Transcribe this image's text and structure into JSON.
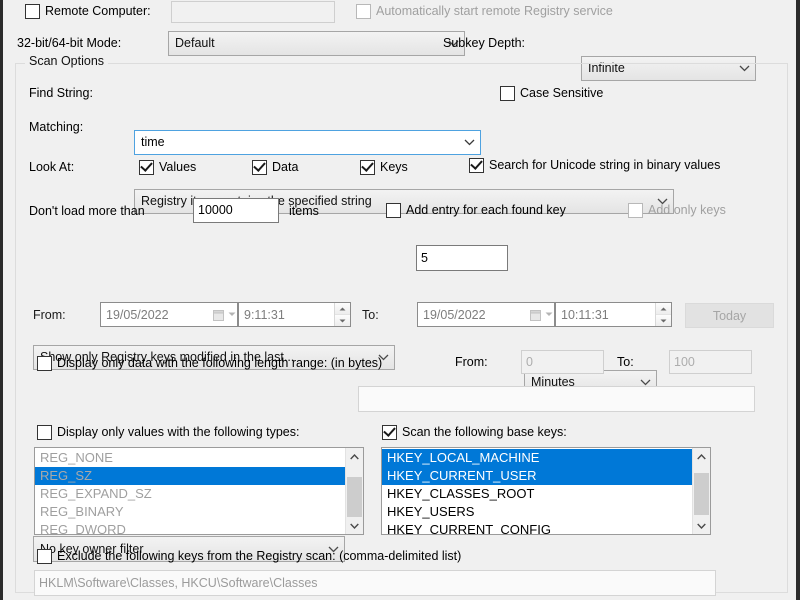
{
  "remote": {
    "checkbox_label": "Remote Computer:",
    "checked": false,
    "computer_value": "",
    "auto_start_label": "Automatically start remote Registry service",
    "auto_start_checked": false,
    "auto_start_disabled": true
  },
  "mode": {
    "bitness_label": "32-bit/64-bit Mode:",
    "bitness_value": "Default",
    "subkey_label": "Subkey Depth:",
    "subkey_value": "Infinite"
  },
  "scan_options": {
    "group_title": "Scan Options",
    "find_string_label": "Find String:",
    "find_string_value": "time",
    "case_sensitive_label": "Case Sensitive",
    "case_sensitive_checked": false,
    "matching_label": "Matching:",
    "matching_value": "Registry item contains the specified string",
    "look_at_label": "Look At:",
    "look_at": [
      {
        "label": "Values",
        "checked": true
      },
      {
        "label": "Data",
        "checked": true
      },
      {
        "label": "Keys",
        "checked": true
      }
    ],
    "unicode_label": "Search for Unicode string in binary values",
    "unicode_checked": true,
    "dont_load_label": "Don't load more than",
    "dont_load_value": "10000",
    "items_label": "items",
    "add_entry_label": "Add entry for each found key",
    "add_entry_checked": false,
    "add_only_keys_label": "Add only keys",
    "add_only_keys_checked": false,
    "add_only_keys_disabled": true,
    "modified_filter_value": "Show only Registry keys modified in the last...",
    "modified_amount": "5",
    "modified_unit": "Minutes",
    "from_label": "From:",
    "from_date": "19/05/2022",
    "from_time": "9:11:31",
    "to_label": "To:",
    "to_date": "19/05/2022",
    "to_time": "10:11:31",
    "today_button": "Today",
    "length_range_label": "Display only data with the following length range: (in bytes)",
    "length_range_checked": false,
    "length_from_label": "From:",
    "length_from_value": "0",
    "length_to_label": "To:",
    "length_to_value": "100",
    "owner_filter_value": "No key owner filter",
    "owner_filter_text": "",
    "types_filter_label": "Display only values with the following types:",
    "types_filter_checked": false,
    "types_list": [
      {
        "label": "REG_NONE",
        "selected": false
      },
      {
        "label": "REG_SZ",
        "selected": true
      },
      {
        "label": "REG_EXPAND_SZ",
        "selected": false
      },
      {
        "label": "REG_BINARY",
        "selected": false
      },
      {
        "label": "REG_DWORD",
        "selected": false
      }
    ],
    "base_keys_label": "Scan the following base keys:",
    "base_keys_checked": true,
    "base_keys_list": [
      {
        "label": "HKEY_LOCAL_MACHINE",
        "selected": true
      },
      {
        "label": "HKEY_CURRENT_USER",
        "selected": true
      },
      {
        "label": "HKEY_CLASSES_ROOT",
        "selected": false
      },
      {
        "label": "HKEY_USERS",
        "selected": false
      },
      {
        "label": "HKEY_CURRENT_CONFIG",
        "selected": false
      }
    ],
    "exclude_label": "Exclude the following keys from the Registry scan: (comma-delimited list)",
    "exclude_checked": false,
    "exclude_value": "HKLM\\Software\\Classes, HKCU\\Software\\Classes"
  },
  "colors": {
    "selection_blue": "#0078d7",
    "focus_border": "#4ea2e0",
    "window_bg": "#f0f0f0",
    "disabled_text": "#a0a0a0"
  }
}
